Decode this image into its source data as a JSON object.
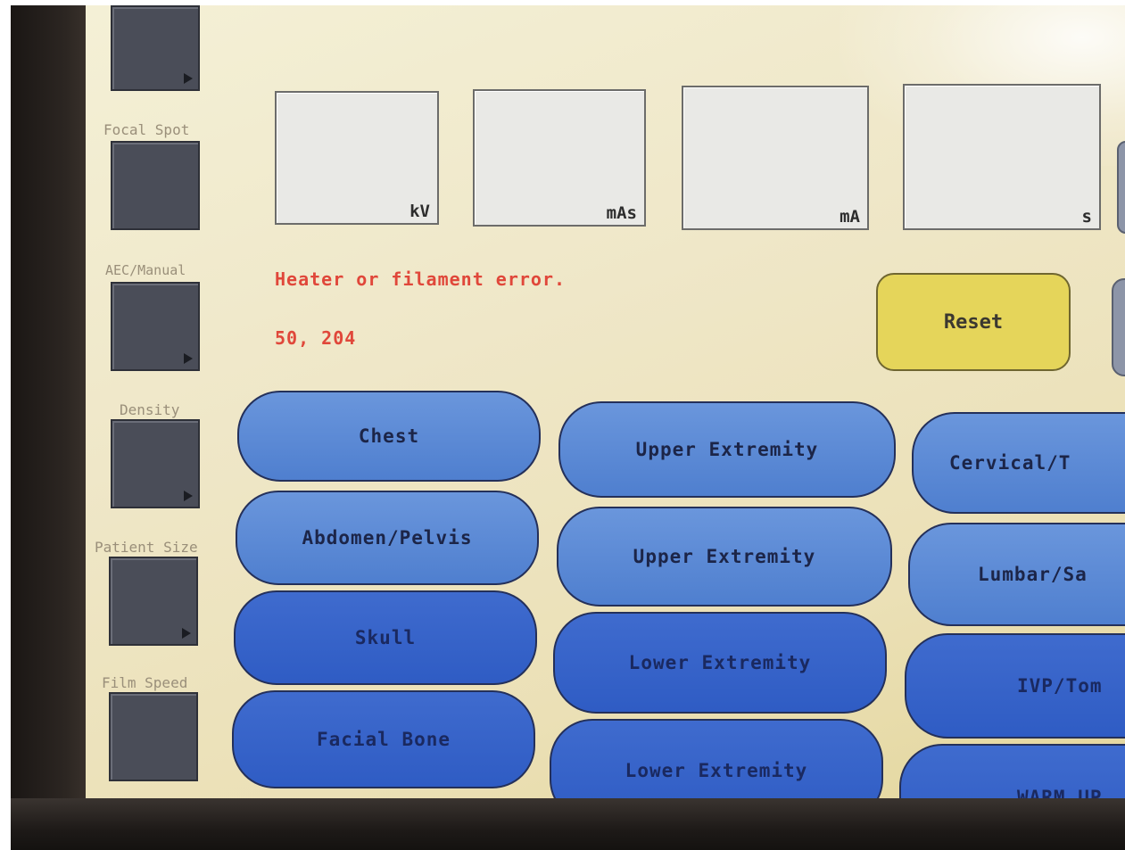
{
  "colors": {
    "screen_bg": "#efe7c8",
    "readout_bg": "#e9e9e6",
    "error_text": "#e0473a",
    "reset_button": "#e5d55a",
    "procedure_button": "#5a88d4",
    "side_box": "#4a4d58"
  },
  "side_panel": {
    "items": [
      {
        "label": "",
        "arrow_icon": "triangle-right-icon"
      },
      {
        "label": "Focal Spot"
      },
      {
        "label": "AEC/Manual",
        "arrow_icon": "triangle-right-icon"
      },
      {
        "label": "Density",
        "arrow_icon": "triangle-right-icon"
      },
      {
        "label": "Patient Size",
        "arrow_icon": "triangle-right-icon"
      },
      {
        "label": "Film Speed",
        "arrow_icon": "triangle-right-icon"
      }
    ]
  },
  "readouts": [
    {
      "unit": "kV",
      "value": ""
    },
    {
      "unit": "mAs",
      "value": ""
    },
    {
      "unit": "mA",
      "value": ""
    },
    {
      "unit": "s",
      "value": ""
    }
  ],
  "status": {
    "message": "Heater or filament error.",
    "code": "50, 204"
  },
  "actions": {
    "reset_label": "Reset"
  },
  "procedures": {
    "column1": [
      "Chest",
      "Abdomen/Pelvis",
      "Skull",
      "Facial Bone"
    ],
    "column2": [
      "Upper Extremity",
      "Upper Extremity",
      "Lower Extremity",
      "Lower Extremity"
    ],
    "column3": [
      "Cervical/T",
      "Lumbar/Sa",
      "IVP/Tom",
      "WARM UP"
    ]
  }
}
